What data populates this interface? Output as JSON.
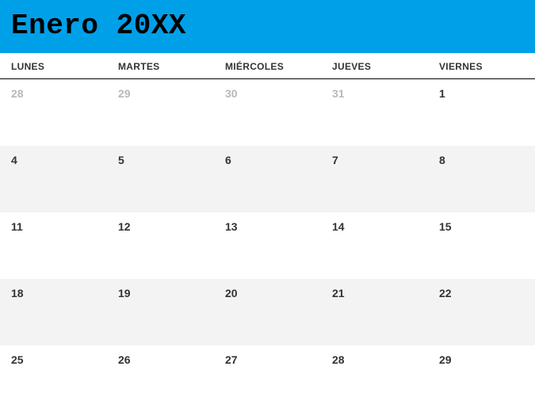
{
  "title": "Enero 20XX",
  "day_headers": [
    "LUNES",
    "MARTES",
    "MIÉRCOLES",
    "JUEVES",
    "VIERNES"
  ],
  "weeks": [
    {
      "shaded": false,
      "days": [
        {
          "num": "28",
          "muted": true
        },
        {
          "num": "29",
          "muted": true
        },
        {
          "num": "30",
          "muted": true
        },
        {
          "num": "31",
          "muted": true
        },
        {
          "num": "1",
          "muted": false
        }
      ]
    },
    {
      "shaded": true,
      "days": [
        {
          "num": "4",
          "muted": false
        },
        {
          "num": "5",
          "muted": false
        },
        {
          "num": "6",
          "muted": false
        },
        {
          "num": "7",
          "muted": false
        },
        {
          "num": "8",
          "muted": false
        }
      ]
    },
    {
      "shaded": false,
      "days": [
        {
          "num": "11",
          "muted": false
        },
        {
          "num": "12",
          "muted": false
        },
        {
          "num": "13",
          "muted": false
        },
        {
          "num": "14",
          "muted": false
        },
        {
          "num": "15",
          "muted": false
        }
      ]
    },
    {
      "shaded": true,
      "days": [
        {
          "num": "18",
          "muted": false
        },
        {
          "num": "19",
          "muted": false
        },
        {
          "num": "20",
          "muted": false
        },
        {
          "num": "21",
          "muted": false
        },
        {
          "num": "22",
          "muted": false
        }
      ]
    },
    {
      "shaded": false,
      "days": [
        {
          "num": "25",
          "muted": false
        },
        {
          "num": "26",
          "muted": false
        },
        {
          "num": "27",
          "muted": false
        },
        {
          "num": "28",
          "muted": false
        },
        {
          "num": "29",
          "muted": false
        }
      ]
    }
  ]
}
